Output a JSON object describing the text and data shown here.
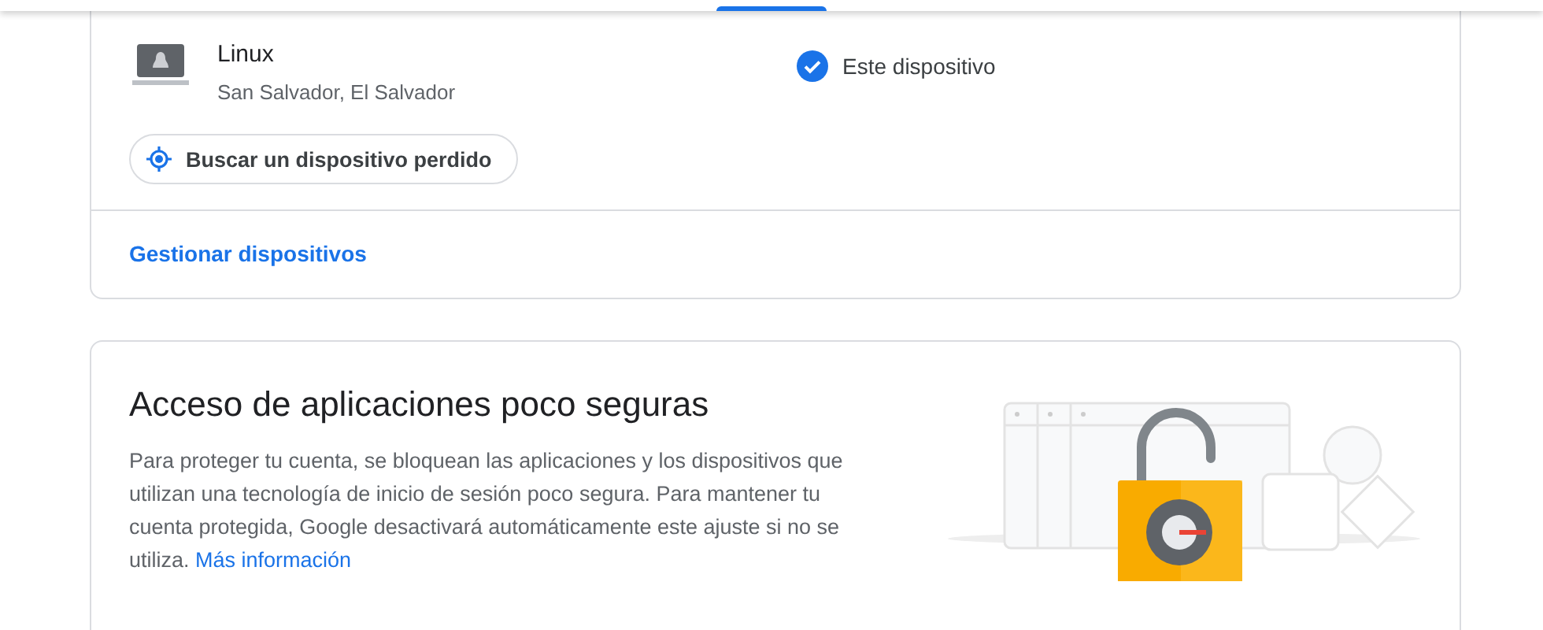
{
  "devices_card": {
    "device": {
      "name": "Linux",
      "location": "San Salvador, El Salvador",
      "status": "Este dispositivo",
      "current": true
    },
    "find_button": "Buscar un dispositivo perdido",
    "manage_link": "Gestionar dispositivos"
  },
  "less_secure_card": {
    "title": "Acceso de aplicaciones poco seguras",
    "description": "Para proteger tu cuenta, se bloquean las aplicaciones y los dispositivos que utilizan una tecnología de inicio de sesión poco segura. Para mantener tu cuenta protegida, Google desactivará automáticamente este ajuste si no se utiliza.",
    "link": "Más información"
  }
}
